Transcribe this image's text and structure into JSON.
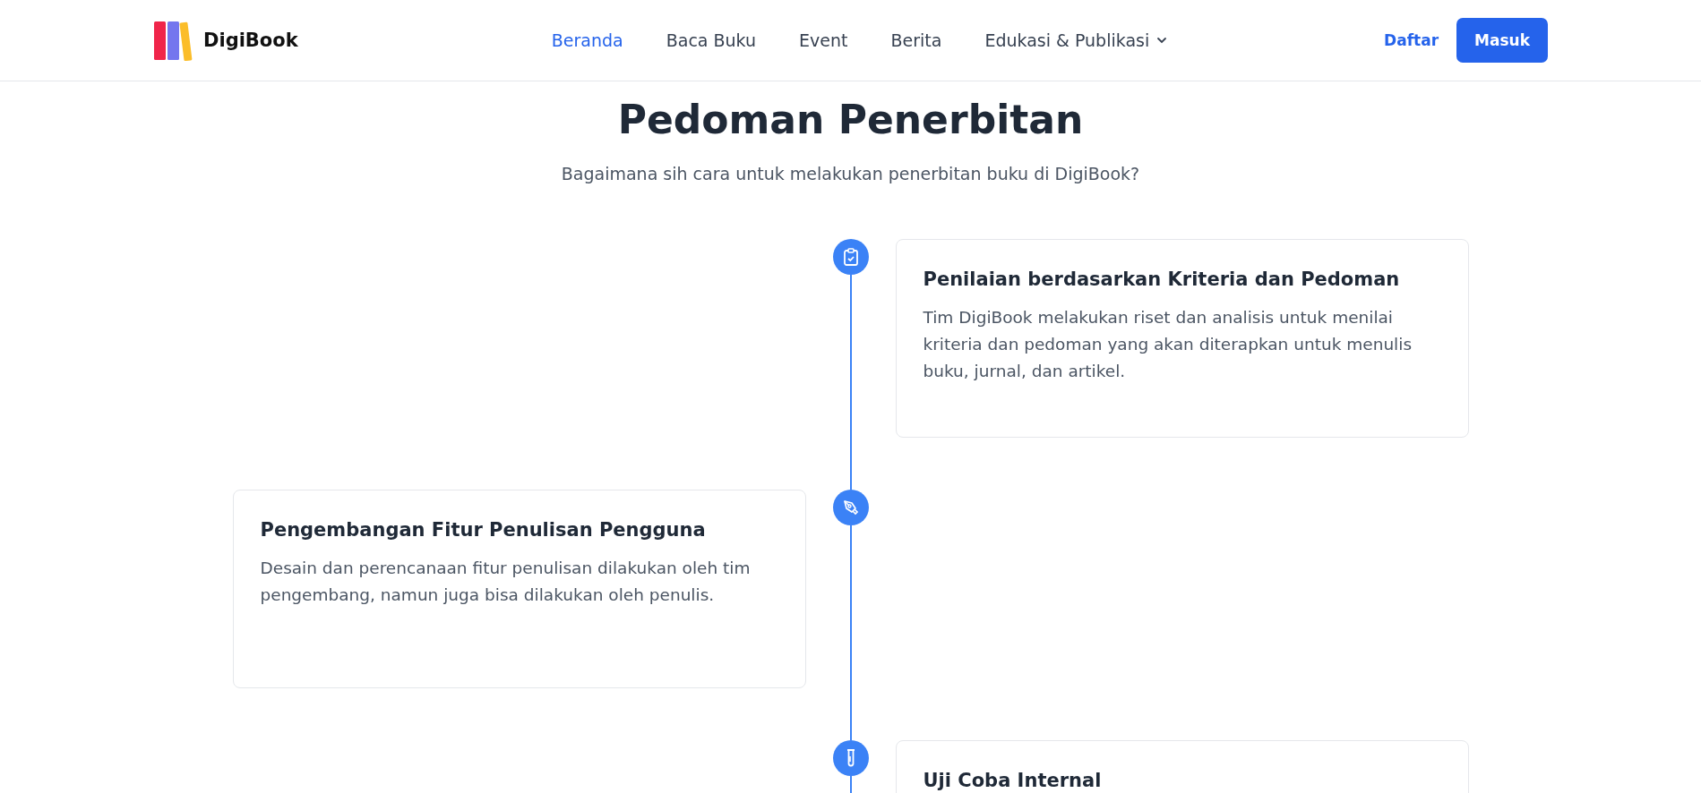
{
  "brand": {
    "name": "DigiBook"
  },
  "nav": [
    {
      "label": "Beranda",
      "selected": true
    },
    {
      "label": "Baca Buku",
      "selected": false
    },
    {
      "label": "Event",
      "selected": false
    },
    {
      "label": "Berita",
      "selected": false
    },
    {
      "label": "Edukasi & Publikasi",
      "selected": false,
      "dropdown": true
    }
  ],
  "auth": {
    "register": "Daftar",
    "login": "Masuk"
  },
  "heading": "Pedoman Penerbitan",
  "subheading": "Bagaimana sih cara untuk melakukan penerbitan buku di DigiBook?",
  "timeline": [
    {
      "kind": "clipboard",
      "title": "Penilaian berdasarkan Kriteria dan Pedoman",
      "text": "Tim DigiBook melakukan riset dan analisis untuk menilai kriteria dan pedoman yang akan diterapkan untuk menulis buku, jurnal, dan artikel."
    },
    {
      "kind": "pen",
      "title": "Pengembangan Fitur Penulisan Pengguna",
      "text": "Desain dan perencanaan fitur penulisan dilakukan oleh tim pengembang, namun juga bisa dilakukan oleh penulis."
    },
    {
      "kind": "tube",
      "title": "Uji Coba Internal"
    }
  ]
}
